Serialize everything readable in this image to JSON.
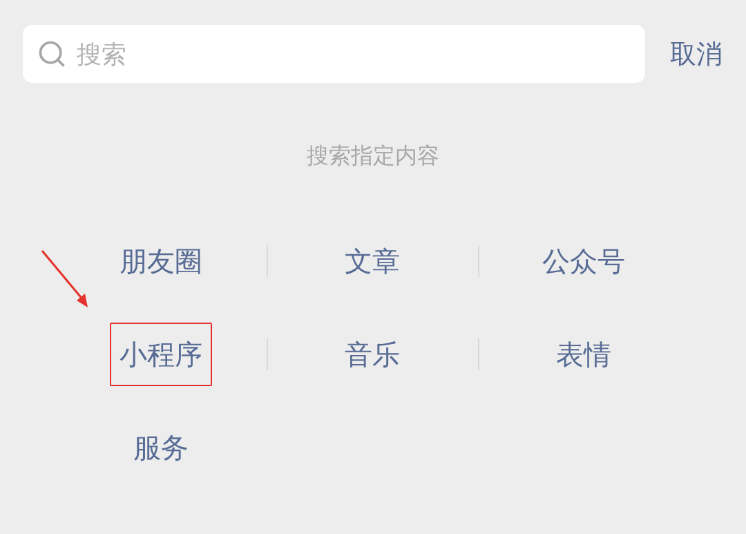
{
  "search": {
    "placeholder": "搜索"
  },
  "cancel_button": "取消",
  "heading": "搜索指定内容",
  "categories": [
    {
      "label": "朋友圈",
      "annotated": false
    },
    {
      "label": "文章",
      "annotated": false
    },
    {
      "label": "公众号",
      "annotated": false
    },
    {
      "label": "小程序",
      "annotated": true
    },
    {
      "label": "音乐",
      "annotated": false
    },
    {
      "label": "表情",
      "annotated": false
    },
    {
      "label": "服务",
      "annotated": false
    }
  ]
}
